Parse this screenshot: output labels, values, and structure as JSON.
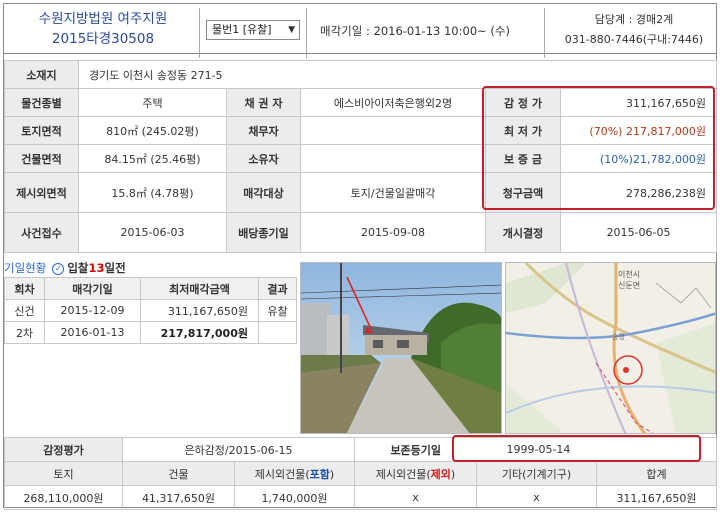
{
  "header": {
    "court_line1": "수원지방법원 여주지원",
    "court_line2": "2015타경30508",
    "item_select": "물번1 [유찰]",
    "sale_date": "매각기일 : 2016-01-13   10:00~ (수)",
    "contact_line1": "담당계 : 경매2계",
    "contact_line2": "031-880-7446(구내:7446)"
  },
  "info": {
    "address_label": "소재지",
    "address": "경기도 이천시 송정동 271-5",
    "type_label": "물건종별",
    "type": "주택",
    "creditor_label": "채 권 자",
    "creditor": "에스비아이저축은행외2명",
    "debtor_label": "채무자",
    "debtor": "",
    "land_area_label": "토지면적",
    "land_area": "810㎡ (245.02평)",
    "building_area_label": "건물면적",
    "building_area": "84.15㎡ (25.46평)",
    "owner_label": "소유자",
    "owner": "",
    "excluded_label": "제시외면적",
    "excluded": "15.8㎡ (4.78평)",
    "sale_target_label": "매각대상",
    "sale_target": "토지/건물일괄매각",
    "case_date_label": "사건접수",
    "case_date": "2015-06-03",
    "dividend_label": "배당종기일",
    "dividend_date": "2015-09-08",
    "start_label": "개시결정",
    "start_date": "2015-06-05",
    "appraisal_label": "감 정 가",
    "appraisal": "311,167,650원",
    "lowest_label": "최 저 가",
    "lowest": "(70%) 217,817,000원",
    "deposit_label": "보 증 금",
    "deposit": "(10%)21,782,000원",
    "claim_label": "청구금액",
    "claim": "278,286,238원"
  },
  "history": {
    "title": "기일현황",
    "badge_prefix": "입찰",
    "badge_days": "13",
    "badge_suffix": "일전",
    "col_round": "회차",
    "col_date": "매각기일",
    "col_price": "최저매각금액",
    "col_result": "결과",
    "rows": [
      {
        "round": "신건",
        "date": "2015-12-09",
        "price": "311,167,650원",
        "result": "유찰"
      },
      {
        "round": "2차",
        "date": "2016-01-13",
        "price": "217,817,000원",
        "result": ""
      }
    ]
  },
  "map": {
    "label1": "이천시",
    "label2": "신둔면",
    "label3": "송정"
  },
  "appraisal": {
    "label": "감정평가",
    "value": "은하감정/2015-06-15",
    "preservation_label": "보존등기일",
    "preservation_date": "1999-05-14",
    "headers": {
      "land": "토지",
      "building": "건물",
      "extra_incl_a": "제시외건물(",
      "extra_incl_b": "포함",
      "extra_excl_a": "제시외건물(",
      "extra_excl_b": "제외",
      "etc": "기타(기계기구)",
      "total": "합계",
      "close": ")"
    },
    "values": {
      "land": "268,110,000원",
      "building": "41,317,650원",
      "extra_incl": "1,740,000원",
      "extra_excl": "x",
      "etc": "x",
      "total": "311,167,650원"
    }
  },
  "colors": {
    "highlight_border": "#c21f2a",
    "court_blue": "#2a4a9a",
    "lowest_red": "#b03a1a",
    "deposit_blue": "#2a5ea8"
  }
}
